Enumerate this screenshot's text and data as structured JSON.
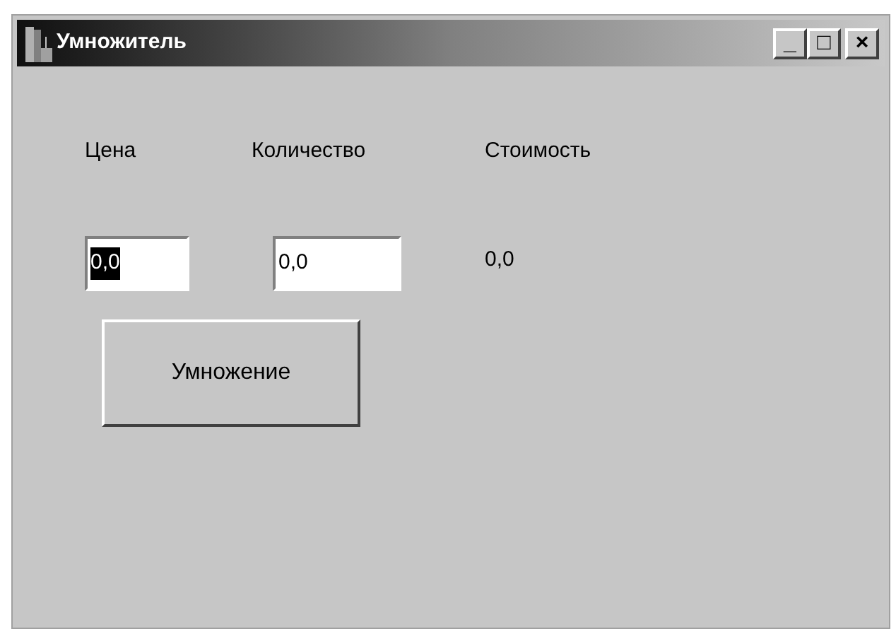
{
  "window": {
    "title": "Умножитель",
    "controls": [
      "_",
      "□",
      "×"
    ]
  },
  "labels": [
    "Цена",
    "Количество",
    "Стоимость"
  ],
  "fields": [
    {
      "value": "0,0",
      "text_selected": true
    },
    {
      "value": "0,0",
      "text_selected": false
    }
  ],
  "result": "0,0",
  "button": "Умножение"
}
